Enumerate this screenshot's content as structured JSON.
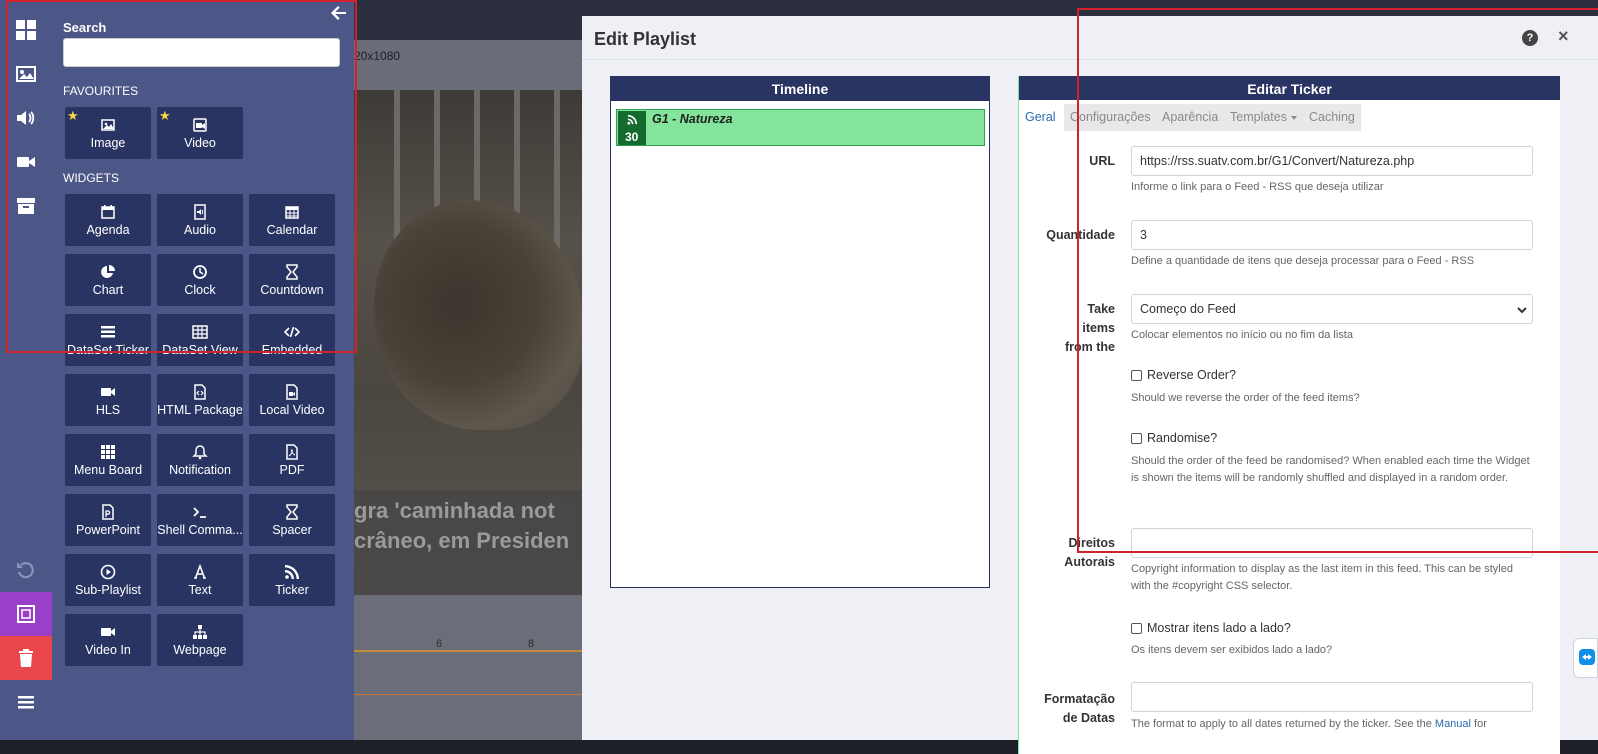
{
  "toolbox": {
    "search_label": "Search",
    "search_value": "",
    "favourites_heading": "FAVOURITES",
    "widgets_heading": "WIDGETS",
    "favourites": [
      {
        "label": "Image",
        "icon": "image-icon"
      },
      {
        "label": "Video",
        "icon": "video-icon"
      }
    ],
    "widgets": [
      {
        "label": "Agenda",
        "icon": "calendar-icon"
      },
      {
        "label": "Audio",
        "icon": "audio-icon"
      },
      {
        "label": "Calendar",
        "icon": "calendar-grid-icon"
      },
      {
        "label": "Chart",
        "icon": "pie-chart-icon"
      },
      {
        "label": "Clock",
        "icon": "clock-icon"
      },
      {
        "label": "Countdown",
        "icon": "hourglass-icon"
      },
      {
        "label": "DataSet Ticker",
        "icon": "list-icon"
      },
      {
        "label": "DataSet View",
        "icon": "table-icon"
      },
      {
        "label": "Embedded",
        "icon": "code-icon"
      },
      {
        "label": "HLS",
        "icon": "video-camera-icon"
      },
      {
        "label": "HTML Package",
        "icon": "file-code-icon"
      },
      {
        "label": "Local Video",
        "icon": "file-video-icon"
      },
      {
        "label": "Menu Board",
        "icon": "grid-icon"
      },
      {
        "label": "Notification",
        "icon": "bell-icon"
      },
      {
        "label": "PDF",
        "icon": "file-pdf-icon"
      },
      {
        "label": "PowerPoint",
        "icon": "file-powerpoint-icon"
      },
      {
        "label": "Shell Comma...",
        "icon": "terminal-icon"
      },
      {
        "label": "Spacer",
        "icon": "hourglass-icon"
      },
      {
        "label": "Sub-Playlist",
        "icon": "play-circle-icon"
      },
      {
        "label": "Text",
        "icon": "font-icon"
      },
      {
        "label": "Ticker",
        "icon": "rss-icon"
      },
      {
        "label": "Video In",
        "icon": "video-camera-icon"
      },
      {
        "label": "Webpage",
        "icon": "sitemap-icon"
      }
    ]
  },
  "background": {
    "resolution_fragment": "20x1080",
    "ticker_line1": "gra 'caminhada not",
    "ticker_line2": "crâneo, em Presiden",
    "ruler_marks": [
      "6",
      "8"
    ]
  },
  "modal": {
    "title": "Edit Playlist",
    "help_symbol": "?",
    "close_symbol": "×",
    "timeline": {
      "heading": "Timeline",
      "item_name": "G1 - Natureza",
      "item_duration": "30"
    },
    "editor": {
      "heading": "Editar Ticker",
      "tabs": [
        "Geral",
        "Configurações",
        "Aparência",
        "Templates",
        "Caching"
      ],
      "active_tab": "Geral",
      "url_label": "URL",
      "url_value": "https://rss.suatv.com.br/G1/Convert/Natureza.php",
      "url_help": "Informe o link para o Feed - RSS que deseja utilizar",
      "quantity_label": "Quantidade",
      "quantity_value": "3",
      "quantity_help": "Define a quantidade de itens que deseja processar para o Feed - RSS",
      "take_label_1": "Take",
      "take_label_2": "items",
      "take_label_3": "from the",
      "take_value": "Começo do Feed",
      "take_help": "Colocar elementos no início ou no fim da lista",
      "reverse_label": "Reverse Order?",
      "reverse_help": "Should we reverse the order of the feed items?",
      "randomise_label": "Randomise?",
      "randomise_help": "Should the order of the feed be randomised? When enabled each time the Widget is shown the items will be randomly shuffled and displayed in a random order.",
      "copyright_label_1": "Direitos",
      "copyright_label_2": "Autorais",
      "copyright_value": "",
      "copyright_help": "Copyright information to display as the last item in this feed. This can be styled with the #copyright CSS selector.",
      "side_label": "Mostrar itens lado a lado?",
      "side_help": "Os itens devem ser exibidos lado a lado?",
      "dateformat_label_1": "Formatação",
      "dateformat_label_2": "de Datas",
      "dateformat_value": "",
      "dateformat_help_prefix": "The format to apply to all dates returned by the ticker. See the",
      "dateformat_help_link": "Manual",
      "dateformat_help_suffix": "for"
    }
  },
  "colors": {
    "panel": "#4c5687",
    "tile": "#2a3463",
    "accent_purple": "#9a3fc7",
    "danger": "#e9474c",
    "timeline_item": "#84e49b",
    "annotation": "#d0222b"
  }
}
